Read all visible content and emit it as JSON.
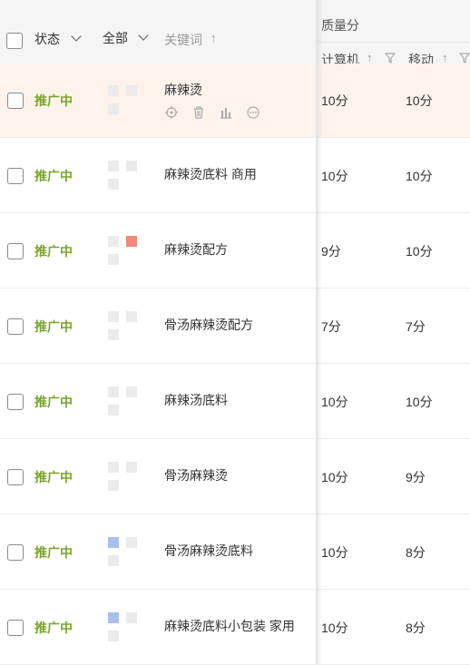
{
  "header": {
    "status_label": "状态",
    "all_label": "全部",
    "keyword_label": "关键词",
    "quality_label": "质量分",
    "computer_label": "计算机",
    "mobile_label": "移动",
    "sort_arrow": "↑"
  },
  "colors": {
    "status_green": "#7aa52b",
    "highlight_row": "#fdf3ea",
    "device_red": "#f08a7e",
    "device_blue": "#a8bff0",
    "device_gray": "#ebebeb"
  },
  "actions": [
    "locate-icon",
    "trash-icon",
    "bar-chart-icon",
    "more-icon"
  ],
  "rows": [
    {
      "status": "推广中",
      "keyword": "麻辣烫",
      "pc": "10分",
      "mobile": "10分",
      "device": "gray"
    },
    {
      "status": "推广中",
      "keyword": "麻辣烫底料 商用",
      "pc": "10分",
      "mobile": "10分",
      "device": "gray"
    },
    {
      "status": "推广中",
      "keyword": "麻辣烫配方",
      "pc": "9分",
      "mobile": "10分",
      "device": "red"
    },
    {
      "status": "推广中",
      "keyword": "骨汤麻辣烫配方",
      "pc": "7分",
      "mobile": "7分",
      "device": "gray"
    },
    {
      "status": "推广中",
      "keyword": "麻辣汤底料",
      "pc": "10分",
      "mobile": "10分",
      "device": "gray"
    },
    {
      "status": "推广中",
      "keyword": "骨汤麻辣烫",
      "pc": "10分",
      "mobile": "9分",
      "device": "gray"
    },
    {
      "status": "推广中",
      "keyword": "骨汤麻辣烫底料",
      "pc": "10分",
      "mobile": "8分",
      "device": "blue"
    },
    {
      "status": "推广中",
      "keyword": "麻辣烫底料小包装 家用",
      "pc": "10分",
      "mobile": "8分",
      "device": "blue"
    }
  ]
}
